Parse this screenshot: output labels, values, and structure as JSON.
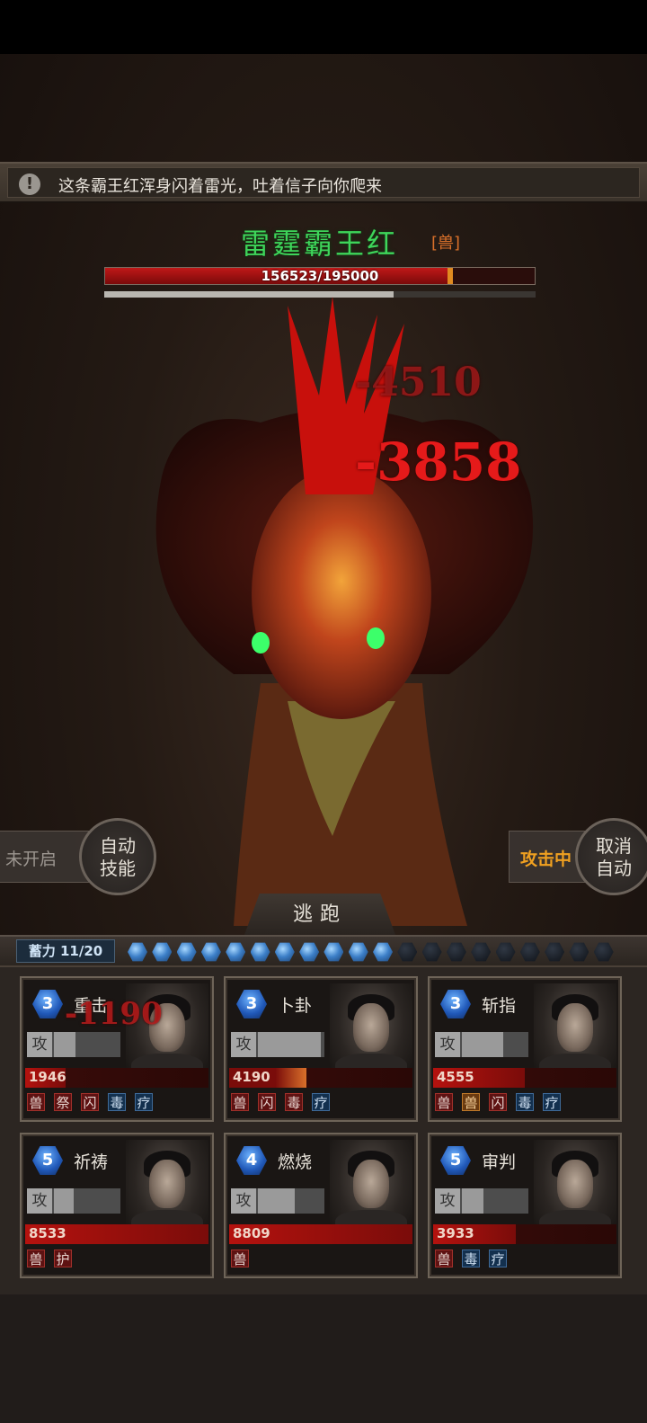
{
  "message": {
    "text": "这条霸王红浑身闪着雷光，吐着信子向你爬来",
    "icon": "exclamation-icon"
  },
  "boss": {
    "name": "雷霆霸王红",
    "type_tag": "[兽]",
    "hp_current": 156523,
    "hp_max": 195000,
    "hp_text": "156523/195000",
    "sub_bar_fraction": 0.67
  },
  "damage_numbers": [
    "-4510",
    "-3858",
    "-1190"
  ],
  "controls": {
    "unopened_label": "未开启",
    "auto_skill": [
      "自动",
      "技能"
    ],
    "attacking_label": "攻击中",
    "cancel_auto": [
      "取消",
      "自动"
    ],
    "flee_label": "逃跑"
  },
  "charge": {
    "label": "蓄力 11/20",
    "current": 11,
    "max": 20
  },
  "cards": [
    {
      "level": "3",
      "skill": "重击",
      "atk_label": "攻",
      "atk_fraction": 0.33,
      "hp": "1946",
      "hp_fraction": 0.22,
      "hp_orange": false,
      "tags": [
        {
          "text": "兽",
          "style": "red"
        },
        {
          "text": "祭",
          "style": "red"
        },
        {
          "text": "闪",
          "style": "red"
        },
        {
          "text": "毒",
          "style": "blue"
        },
        {
          "text": "疗",
          "style": "blue"
        }
      ]
    },
    {
      "level": "3",
      "skill": "卜卦",
      "atk_label": "攻",
      "atk_fraction": 0.95,
      "hp": "4190",
      "hp_fraction": 0.42,
      "hp_orange": true,
      "tags": [
        {
          "text": "兽",
          "style": "red"
        },
        {
          "text": "闪",
          "style": "red"
        },
        {
          "text": "毒",
          "style": "red"
        },
        {
          "text": "疗",
          "style": "blue"
        }
      ]
    },
    {
      "level": "3",
      "skill": "斩指",
      "atk_label": "攻",
      "atk_fraction": 0.62,
      "hp": "4555",
      "hp_fraction": 0.5,
      "hp_orange": false,
      "tags": [
        {
          "text": "兽",
          "style": "red"
        },
        {
          "text": "兽",
          "style": "orange"
        },
        {
          "text": "闪",
          "style": "red"
        },
        {
          "text": "毒",
          "style": "blue"
        },
        {
          "text": "疗",
          "style": "blue"
        }
      ]
    },
    {
      "level": "5",
      "skill": "祈祷",
      "atk_label": "攻",
      "atk_fraction": 0.3,
      "hp": "8533",
      "hp_fraction": 1.0,
      "hp_orange": false,
      "tags": [
        {
          "text": "兽",
          "style": "red"
        },
        {
          "text": "护",
          "style": "red"
        }
      ]
    },
    {
      "level": "4",
      "skill": "燃烧",
      "atk_label": "攻",
      "atk_fraction": 0.55,
      "hp": "8809",
      "hp_fraction": 1.0,
      "hp_orange": false,
      "tags": [
        {
          "text": "兽",
          "style": "red"
        }
      ]
    },
    {
      "level": "5",
      "skill": "审判",
      "atk_label": "攻",
      "atk_fraction": 0.32,
      "hp": "3933",
      "hp_fraction": 0.45,
      "hp_orange": false,
      "tags": [
        {
          "text": "兽",
          "style": "red"
        },
        {
          "text": "毒",
          "style": "blue"
        },
        {
          "text": "疗",
          "style": "blue"
        }
      ]
    }
  ],
  "colors": {
    "boss_name": "#3ed55a",
    "damage": "#e51a1a",
    "attacking": "#f0a020",
    "charge_gem": "#3c7fc8"
  }
}
